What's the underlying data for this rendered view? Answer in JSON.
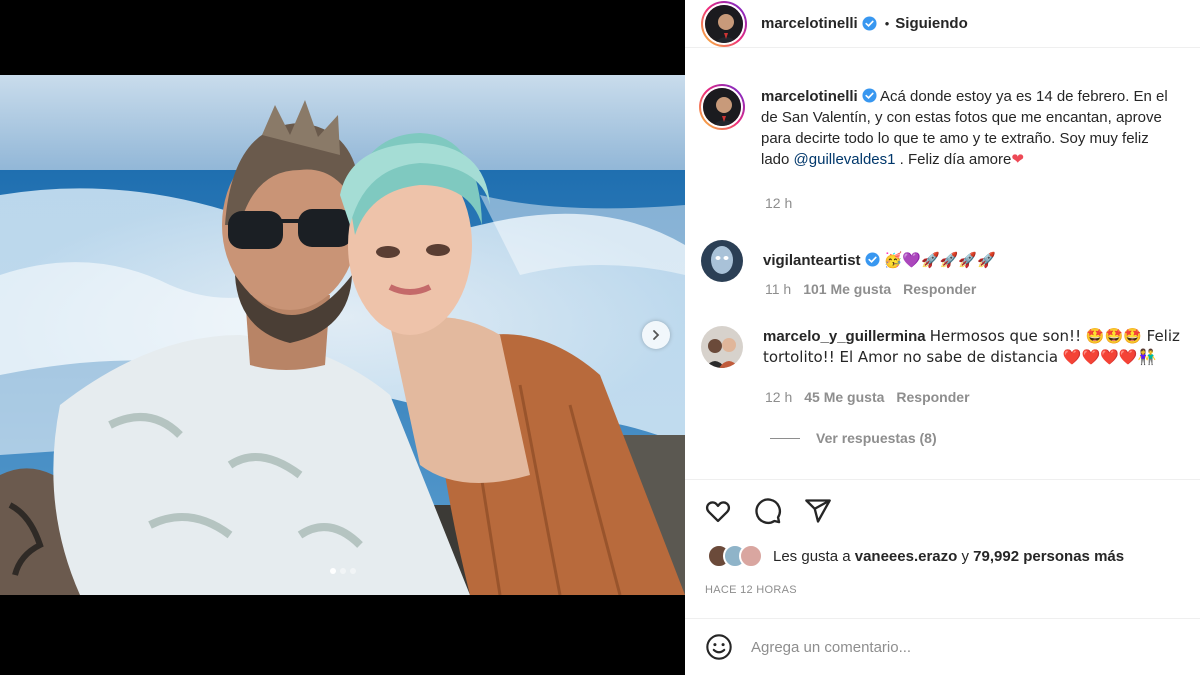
{
  "post": {
    "author": "marcelotinelli",
    "separator": "•",
    "follow_status": "Siguiendo",
    "caption_line1": "Acá donde estoy ya es 14 de febrero. En el",
    "caption_line2": "de San Valentín, y con estas fotos que me encantan, aprove",
    "caption_line3": "para decirte todo lo que te amo y te extraño. Soy muy feliz",
    "caption_line4_pre": "lado",
    "caption_mention": "@guillevaldes1",
    "caption_line4_post": ". Feliz día amore",
    "caption_emoji": "❤",
    "caption_time": "12 h",
    "carousel_next_icon": "chevron-right-icon",
    "carousel_slides": 3,
    "carousel_active_index": 0
  },
  "comments": [
    {
      "user": "vigilanteartist",
      "text": "🥳💜🚀🚀🚀🚀",
      "time": "11 h",
      "likes": "101 Me gusta",
      "reply": "Responder"
    },
    {
      "user": "marcelo_y_guillermina",
      "text_line1": "Hermosos que son!! 🤩🤩🤩 Feliz",
      "text_line2": "tortolito!! El Amor no sabe de distancia ❤️❤️❤️❤️👫",
      "time": "12 h",
      "likes": "45 Me gusta",
      "reply": "Responder",
      "view_replies": "Ver respuestas (8)"
    }
  ],
  "actions": {
    "like_icon": "heart-icon",
    "comment_icon": "comment-icon",
    "share_icon": "share-icon"
  },
  "likes": {
    "prefix": "Les gusta a",
    "user": "vaneees.erazo",
    "middle": "y",
    "count": "79,992 personas más"
  },
  "time_ago": "HACE 12 HORAS",
  "comment_input": {
    "placeholder": "Agrega un comentario...",
    "emoji_icon": "smiley-icon"
  },
  "colors": {
    "verified": "#3897f0",
    "text": "#262626",
    "muted": "#8e8e8e",
    "mention": "#00376b",
    "heart": "#ed4956"
  }
}
